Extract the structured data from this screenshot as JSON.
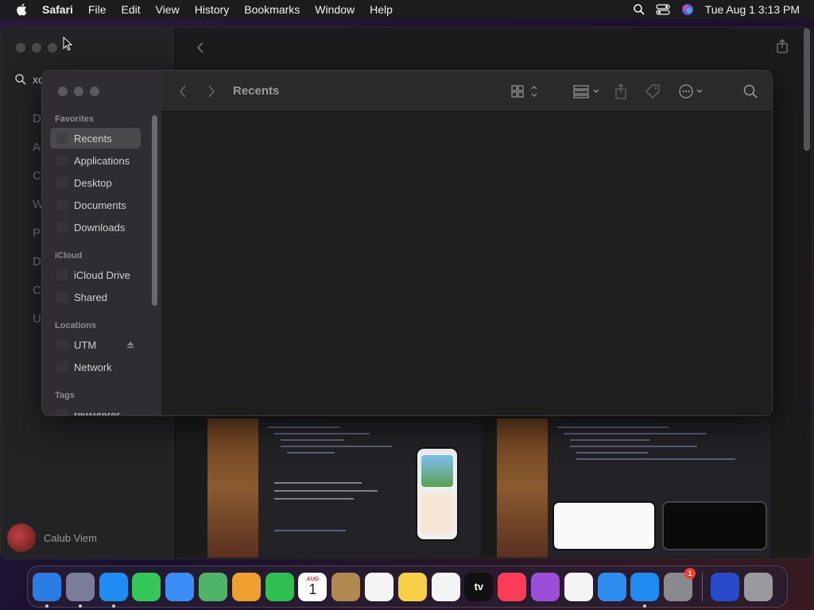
{
  "menubar": {
    "app_name": "Safari",
    "items": [
      "File",
      "Edit",
      "View",
      "History",
      "Bookmarks",
      "Window",
      "Help"
    ],
    "clock": "Tue Aug 1  3:13 PM"
  },
  "safari": {
    "search_text": "xc",
    "sidebar_letters": [
      "D",
      "A",
      "C",
      "W",
      "P",
      "D",
      "C",
      "U"
    ],
    "user_name": "Calub Viem"
  },
  "finder": {
    "title": "Recents",
    "favorites_header": "Favorites",
    "favorites": [
      "Recents",
      "Applications",
      "Desktop",
      "Documents",
      "Downloads"
    ],
    "icloud_header": "iCloud",
    "icloud": [
      "iCloud Drive",
      "Shared"
    ],
    "locations_header": "Locations",
    "locations": [
      "UTM",
      "Network"
    ],
    "tags_header": "Tags",
    "tags": [
      "rewwrerer"
    ]
  },
  "dock": {
    "apps": [
      {
        "name": "Finder",
        "color": "#2a7de1",
        "running": true
      },
      {
        "name": "Launchpad",
        "color": "#7b7b9a",
        "running": true
      },
      {
        "name": "Safari",
        "color": "#1e8cf0",
        "running": true
      },
      {
        "name": "Messages",
        "color": "#35c759",
        "running": false
      },
      {
        "name": "Mail",
        "color": "#3b8ef5",
        "running": false
      },
      {
        "name": "Maps",
        "color": "#4fb36a",
        "running": false
      },
      {
        "name": "Photos",
        "color": "#f0a030",
        "running": false
      },
      {
        "name": "FaceTime",
        "color": "#30c050",
        "running": false
      },
      {
        "name": "Calendar",
        "color": "#ffffff",
        "running": false,
        "month": "AUG",
        "day": "1"
      },
      {
        "name": "Contacts",
        "color": "#b08850",
        "running": false
      },
      {
        "name": "Reminders",
        "color": "#f4f4f4",
        "running": false
      },
      {
        "name": "Notes",
        "color": "#f8d048",
        "running": false
      },
      {
        "name": "Freeform",
        "color": "#f4f4f4",
        "running": false
      },
      {
        "name": "TV",
        "color": "#111111",
        "running": false,
        "label": "tv"
      },
      {
        "name": "Music",
        "color": "#fa3c58",
        "running": false
      },
      {
        "name": "Podcasts",
        "color": "#9b4fd8",
        "running": false
      },
      {
        "name": "News",
        "color": "#f4f4f4",
        "running": false
      },
      {
        "name": "Keynote",
        "color": "#2d8ef0",
        "running": false
      },
      {
        "name": "App Store",
        "color": "#1e8cf0",
        "running": true
      },
      {
        "name": "System Settings",
        "color": "#8a8a8e",
        "running": false,
        "badge": "1"
      }
    ],
    "after_sep": [
      {
        "name": "Screen Sharing",
        "color": "#2a4acc"
      },
      {
        "name": "Trash",
        "color": "#9a9a9e"
      }
    ]
  }
}
